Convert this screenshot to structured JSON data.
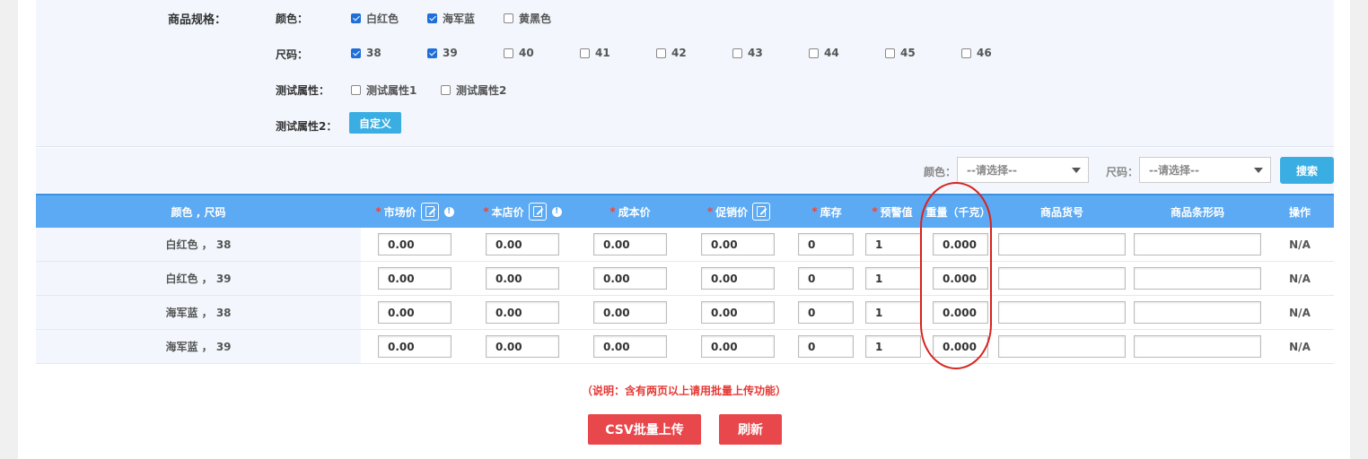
{
  "spec": {
    "title": "商品规格：",
    "color_label": "颜色：",
    "size_label": "尺码：",
    "test_label": "测试属性：",
    "test2_label": "测试属性2：",
    "custom_button": "自定义",
    "colors": [
      {
        "label": "白红色",
        "checked": true
      },
      {
        "label": "海军蓝",
        "checked": true
      },
      {
        "label": "黄黑色",
        "checked": false
      }
    ],
    "sizes": [
      {
        "label": "38",
        "checked": true
      },
      {
        "label": "39",
        "checked": true
      },
      {
        "label": "40",
        "checked": false
      },
      {
        "label": "41",
        "checked": false
      },
      {
        "label": "42",
        "checked": false
      },
      {
        "label": "43",
        "checked": false
      },
      {
        "label": "44",
        "checked": false
      },
      {
        "label": "45",
        "checked": false
      },
      {
        "label": "46",
        "checked": false
      }
    ],
    "tests": [
      {
        "label": "测试属性1",
        "checked": false
      },
      {
        "label": "测试属性2",
        "checked": false
      }
    ]
  },
  "filter": {
    "color_label": "颜色：",
    "color_value": "--请选择--",
    "size_label": "尺码：",
    "size_value": "--请选择--",
    "search_button": "搜索"
  },
  "table": {
    "headers": {
      "spec": "颜色 , 尺码",
      "market_price": "市场价",
      "store_price": "本店价",
      "cost_price": "成本价",
      "promo_price": "促销价",
      "stock": "库存",
      "alert": "预警值",
      "weight": "重量（千克）",
      "sku": "商品货号",
      "barcode": "商品条形码",
      "action": "操作"
    },
    "required_mark": "*",
    "info_mark": "!",
    "rows": [
      {
        "spec": "白红色 ， 38",
        "market": "0.00",
        "store": "0.00",
        "cost": "0.00",
        "promo": "0.00",
        "stock": "0",
        "alert": "1",
        "weight": "0.000",
        "sku": "",
        "barcode": "",
        "action": "N/A"
      },
      {
        "spec": "白红色 ， 39",
        "market": "0.00",
        "store": "0.00",
        "cost": "0.00",
        "promo": "0.00",
        "stock": "0",
        "alert": "1",
        "weight": "0.000",
        "sku": "",
        "barcode": "",
        "action": "N/A"
      },
      {
        "spec": "海军蓝 ， 38",
        "market": "0.00",
        "store": "0.00",
        "cost": "0.00",
        "promo": "0.00",
        "stock": "0",
        "alert": "1",
        "weight": "0.000",
        "sku": "",
        "barcode": "",
        "action": "N/A"
      },
      {
        "spec": "海军蓝 ， 39",
        "market": "0.00",
        "store": "0.00",
        "cost": "0.00",
        "promo": "0.00",
        "stock": "0",
        "alert": "1",
        "weight": "0.000",
        "sku": "",
        "barcode": "",
        "action": "N/A"
      }
    ]
  },
  "note": "（说明：含有两页以上请用批量上传功能）",
  "buttons": {
    "csv_upload": "CSV批量上传",
    "refresh": "刷新"
  },
  "colors": {
    "header_bg": "#5caaf3",
    "accent": "#3aaee3",
    "danger": "#e8474b",
    "annotation": "#d6241f"
  }
}
